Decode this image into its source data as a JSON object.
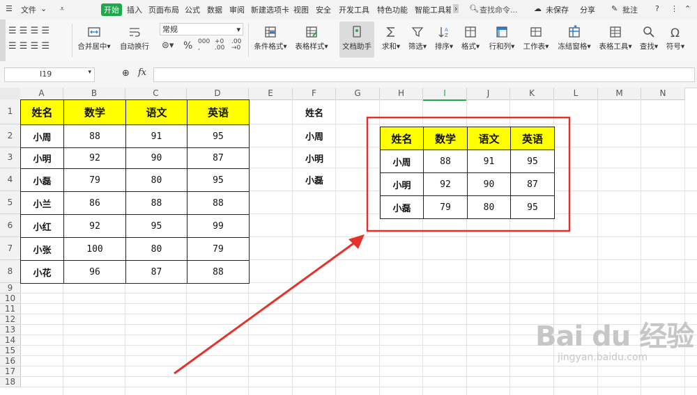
{
  "menu": {
    "file": "文件",
    "tabs": [
      "开始",
      "插入",
      "页面布局",
      "公式",
      "数据",
      "审阅",
      "新建选项卡",
      "视图",
      "安全",
      "开发工具",
      "特色功能",
      "智能工具箱"
    ],
    "active": "开始",
    "search": "查找命令...",
    "unsaved": "未保存",
    "share": "分享",
    "comment": "批注"
  },
  "ribbon": {
    "merge": "合并居中",
    "wrap": "自动换行",
    "number_format": "常规",
    "percent": "%",
    "cond_format": "条件格式",
    "table_style": "表格样式",
    "doc_helper": "文档助手",
    "sum": "求和",
    "filter": "筛选",
    "sort": "排序",
    "format": "格式",
    "rowcol": "行和列",
    "sheet": "工作表",
    "freeze": "冻结窗格",
    "table_tools": "表格工具",
    "find": "查找",
    "symbol": "符号"
  },
  "formula_bar": {
    "cell_ref": "I19",
    "fx": "fx",
    "value": ""
  },
  "columns": [
    "A",
    "B",
    "C",
    "D",
    "E",
    "F",
    "G",
    "H",
    "I",
    "J",
    "K",
    "L",
    "M",
    "N"
  ],
  "rows": [
    "1",
    "2",
    "3",
    "4",
    "5",
    "6",
    "7",
    "8",
    "9",
    "10",
    "11",
    "12",
    "13",
    "14",
    "15",
    "16",
    "17",
    "18"
  ],
  "main_table": {
    "headers": [
      "姓名",
      "数学",
      "语文",
      "英语"
    ],
    "rows": [
      [
        "小周",
        "88",
        "91",
        "95"
      ],
      [
        "小明",
        "92",
        "90",
        "87"
      ],
      [
        "小磊",
        "79",
        "80",
        "95"
      ],
      [
        "小兰",
        "86",
        "88",
        "88"
      ],
      [
        "小红",
        "92",
        "95",
        "99"
      ],
      [
        "小张",
        "100",
        "80",
        "79"
      ],
      [
        "小花",
        "96",
        "87",
        "88"
      ]
    ]
  },
  "lookup_list": [
    "姓名",
    "小周",
    "小明",
    "小磊"
  ],
  "result_table": {
    "headers": [
      "姓名",
      "数学",
      "语文",
      "英语"
    ],
    "rows": [
      [
        "小周",
        "88",
        "91",
        "95"
      ],
      [
        "小明",
        "92",
        "90",
        "87"
      ],
      [
        "小磊",
        "79",
        "80",
        "95"
      ]
    ]
  },
  "watermark": {
    "brand": "Bai du 经验",
    "url": "jingyan.baidu.com"
  },
  "colors": {
    "header_fill": "#ffff00",
    "highlight": "#e8302a",
    "active_tab": "#1da94a"
  }
}
